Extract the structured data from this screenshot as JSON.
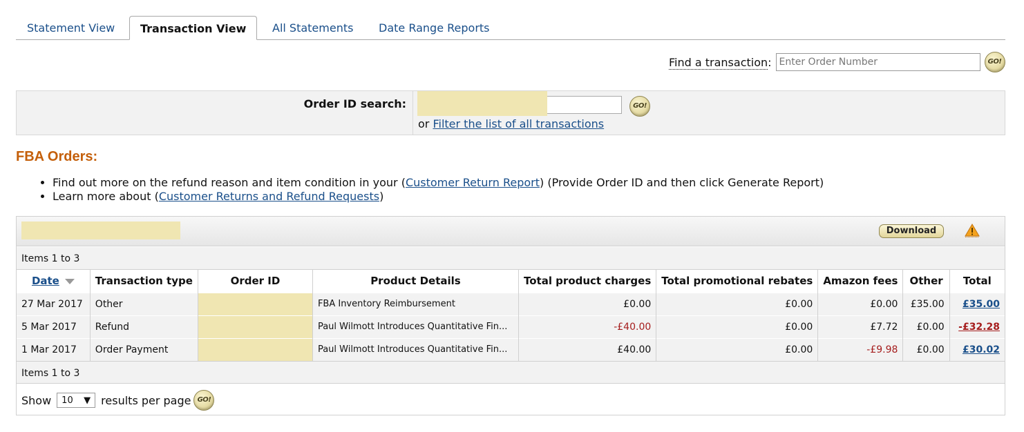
{
  "tabs": [
    {
      "label": "Statement View",
      "active": false
    },
    {
      "label": "Transaction View",
      "active": true
    },
    {
      "label": "All Statements",
      "active": false
    },
    {
      "label": "Date Range Reports",
      "active": false
    }
  ],
  "find": {
    "label_underlined": "Find a transaction",
    "label_suffix": ":",
    "placeholder": "Enter Order Number",
    "go_label": "GO!"
  },
  "order_search": {
    "label": "Order ID search:",
    "go_label": "GO!",
    "or_text": "or",
    "filter_link": "Filter the list of all transactions"
  },
  "fba": {
    "title": "FBA Orders:",
    "bullet1_pre": "Find out more on the refund reason and item condition in your (",
    "bullet1_link": "Customer Return Report",
    "bullet1_post": ") (Provide Order ID and then click Generate Report)",
    "bullet2_pre": "Learn more about (",
    "bullet2_link": "Customer Returns and Refund Requests",
    "bullet2_post": ")"
  },
  "results": {
    "download_label": "Download",
    "items_top": "Items 1 to 3",
    "items_bottom": "Items 1 to 3",
    "columns": {
      "date": "Date",
      "type": "Transaction type",
      "order_id": "Order ID",
      "product": "Product Details",
      "charges": "Total product charges",
      "rebates": "Total promotional rebates",
      "fees": "Amazon fees",
      "other": "Other",
      "total": "Total"
    },
    "rows": [
      {
        "date": "27 Mar 2017",
        "type": "Other",
        "product": "FBA Inventory Reimbursement",
        "charges": "£0.00",
        "rebates": "£0.00",
        "fees": "£0.00",
        "other": "£35.00",
        "total": "£35.00"
      },
      {
        "date": "5 Mar 2017",
        "type": "Refund",
        "product": "Paul Wilmott Introduces Quantitative Fin...",
        "charges": "-£40.00",
        "rebates": "£0.00",
        "fees": "£7.72",
        "other": "£0.00",
        "total": "-£32.28"
      },
      {
        "date": "1 Mar 2017",
        "type": "Order Payment",
        "product": "Paul Wilmott Introduces Quantitative Fin...",
        "charges": "£40.00",
        "rebates": "£0.00",
        "fees": "-£9.98",
        "other": "£0.00",
        "total": "£30.02"
      }
    ],
    "show_label": "Show",
    "per_page_value": "10",
    "per_page_suffix": "results per page",
    "go_label": "GO!"
  },
  "colors": {
    "link": "#1a4f8a",
    "fba_title": "#c45f0a",
    "negative": "#a51d1d",
    "redaction": "#f0e6b2"
  }
}
